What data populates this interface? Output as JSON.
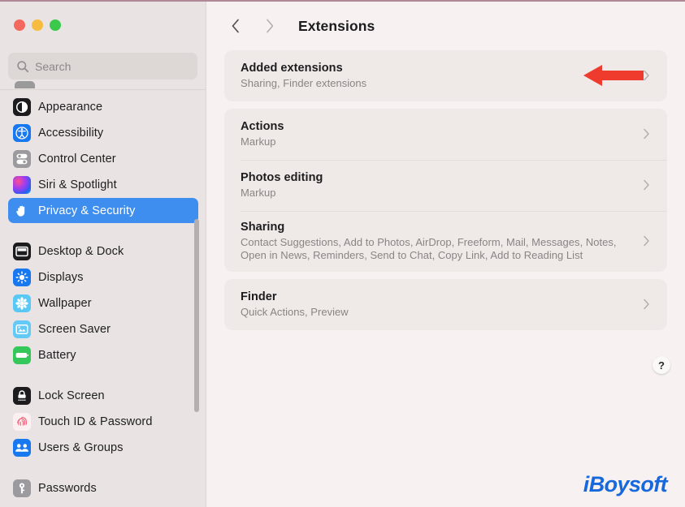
{
  "window": {
    "traffic_lights": [
      {
        "name": "close",
        "color": "#f4695e"
      },
      {
        "name": "minimize",
        "color": "#f6bc3f"
      },
      {
        "name": "zoom",
        "color": "#3bc94b"
      }
    ]
  },
  "sidebar": {
    "search": {
      "value": "",
      "placeholder": "Search"
    },
    "groups": [
      {
        "items": [
          {
            "label": "Appearance",
            "icon": "appearance-icon",
            "selected": false
          },
          {
            "label": "Accessibility",
            "icon": "accessibility-icon",
            "selected": false
          },
          {
            "label": "Control Center",
            "icon": "control-center-icon",
            "selected": false
          },
          {
            "label": "Siri & Spotlight",
            "icon": "siri-icon",
            "selected": false
          },
          {
            "label": "Privacy & Security",
            "icon": "privacy-icon",
            "selected": true
          }
        ]
      },
      {
        "items": [
          {
            "label": "Desktop & Dock",
            "icon": "desktop-dock-icon",
            "selected": false
          },
          {
            "label": "Displays",
            "icon": "displays-icon",
            "selected": false
          },
          {
            "label": "Wallpaper",
            "icon": "wallpaper-icon",
            "selected": false
          },
          {
            "label": "Screen Saver",
            "icon": "screen-saver-icon",
            "selected": false
          },
          {
            "label": "Battery",
            "icon": "battery-icon",
            "selected": false
          }
        ]
      },
      {
        "items": [
          {
            "label": "Lock Screen",
            "icon": "lock-screen-icon",
            "selected": false
          },
          {
            "label": "Touch ID & Password",
            "icon": "touch-id-icon",
            "selected": false
          },
          {
            "label": "Users & Groups",
            "icon": "users-groups-icon",
            "selected": false
          }
        ]
      },
      {
        "items": [
          {
            "label": "Passwords",
            "icon": "passwords-icon",
            "selected": false
          }
        ]
      }
    ]
  },
  "toolbar": {
    "back_icon": "chevron-left-icon",
    "forward_icon": "chevron-right-icon",
    "title": "Extensions"
  },
  "main": {
    "cards": [
      {
        "rows": [
          {
            "title": "Added extensions",
            "subtitle": "Sharing, Finder extensions",
            "disclosure": "chevron-right-icon"
          }
        ]
      },
      {
        "rows": [
          {
            "title": "Actions",
            "subtitle": "Markup",
            "disclosure": "chevron-right-icon"
          },
          {
            "title": "Photos editing",
            "subtitle": "Markup",
            "disclosure": "chevron-right-icon"
          },
          {
            "title": "Sharing",
            "subtitle": "Contact Suggestions, Add to Photos, AirDrop, Freeform, Mail, Messages, Notes, Open in News, Reminders, Send to Chat, Copy Link, Add to Reading List",
            "disclosure": "chevron-right-icon"
          }
        ]
      },
      {
        "rows": [
          {
            "title": "Finder",
            "subtitle": "Quick Actions, Preview",
            "disclosure": "chevron-right-icon"
          }
        ]
      }
    ],
    "help_button": {
      "label": "?",
      "icon": "help-icon"
    },
    "annotation": {
      "icon": "red-left-arrow",
      "color": "#ef3b2d"
    },
    "watermark": "iBoysoft"
  },
  "colors": {
    "accent": "#3e8ef0",
    "sidebar_bg": "#e9e4e3",
    "content_bg": "#f7f1f1",
    "card_bg": "#efe9e8",
    "annotation_red": "#ef3b2d",
    "watermark_blue": "#1668dc"
  }
}
